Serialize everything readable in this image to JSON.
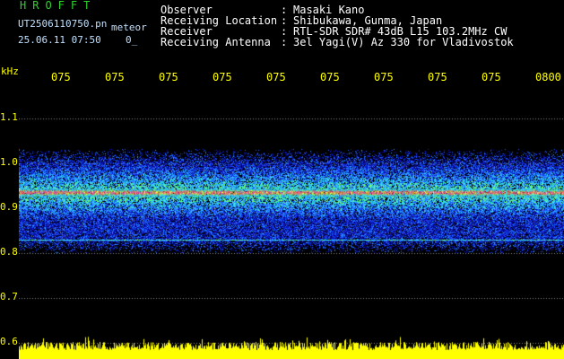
{
  "header": {
    "logo": "HROFFT",
    "filename": "UT2506110750.pn",
    "kind": "meteor",
    "datetime": "25.06.11 07:50",
    "code": "0_",
    "fields": [
      {
        "label": "Observer",
        "value": "Masaki Kano"
      },
      {
        "label": "Receiving Location",
        "value": "Shibukawa, Gunma, Japan"
      },
      {
        "label": "Receiver",
        "value": "RTL-SDR SDR# 43dB L15 103.2MHz CW"
      },
      {
        "label": "Receiving Antenna",
        "value": "3el Yagi(V) Az 330 for Vladivostok"
      }
    ]
  },
  "colors": {
    "text": "#ffffff",
    "axis": "#ffff00",
    "logo": "#2fd22f",
    "background": "#000000"
  },
  "chart_data": {
    "type": "heatmap",
    "ylabel": "kHz",
    "yticks": [
      "1.1",
      "1.0",
      "0.9",
      "0.8",
      "0.7",
      "0.6"
    ],
    "xticks": [
      "075",
      "075",
      "075",
      "075",
      "075",
      "075",
      "075",
      "075",
      "075",
      "0800"
    ],
    "ylim": [
      0.6,
      1.15
    ],
    "bands": [
      {
        "freq": 0.935,
        "kind": "carrier"
      },
      {
        "freq": 0.83,
        "kind": "spur"
      }
    ],
    "noise_range_khz": [
      0.8,
      1.03
    ]
  }
}
